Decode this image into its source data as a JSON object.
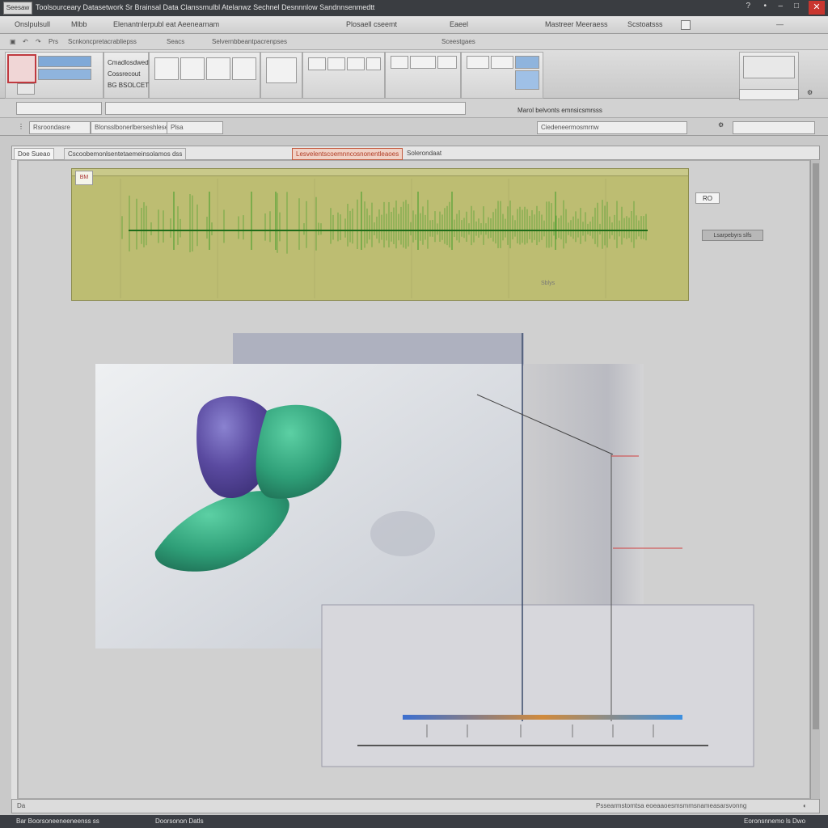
{
  "titlebar": {
    "app_button": "Seesaw",
    "title": "Toolsourceary Datasetwork   Sr Brainsal Data  Clanssmulbl Atelanwz   Sechnel Desnnnlow Sandnnsenmedtt",
    "close_glyph": "✕"
  },
  "menubar": {
    "items": [
      "Onslpulsull",
      "Mlbb",
      "Elenantnlerpubl eat Aeenearnam",
      "Plosaell cseemt",
      "Eaeel",
      "Mastreer Meeraess",
      "Scstoatsss"
    ]
  },
  "tabrow": {
    "items": [
      "Prs",
      "Scnkoncpretacrabliepss",
      "Seacs",
      "Selvernbbeantpacrenpses",
      "Sceestgaes"
    ]
  },
  "ribbon": {
    "item1": "Cmadlosdwed",
    "item2": "Cossrecout",
    "item3": "BG BSOLCET",
    "right_label": "Marol belvonts emnsicsmrsss"
  },
  "toolbar2": {
    "f1": "Rsroondasre",
    "f2": "Blonsslbonerlberseshlese",
    "f3": "Plsa",
    "f4": "Ciedeneermosmrnw"
  },
  "doctabs": {
    "tab1": "Doe Sueao",
    "tab2": "Cscoobemonlsentetaemeinsolamos dss",
    "tab3_active": "Lesvelentscoemnncosnonentleaoes",
    "tab4": "Solerondaat"
  },
  "wave": {
    "badge": "BM",
    "xlabel": "Sblys",
    "side_badge": "RO",
    "side_button": "Lsarpebyrs slfs",
    "accent": "#3c9a26",
    "baseline": "#1f6b19",
    "background": "#bdbd72"
  },
  "plot3d": {
    "color_purple": "#5a4aa0",
    "color_green": "#2e9e77",
    "axis_color": "#6a7a9a"
  },
  "statusbar": {
    "left": "Da",
    "right": "Pssearmstomtsa eoeaaoesmsmmsnameasarsvonng"
  },
  "taskbar": {
    "left": "Bar Boorsoneeneeneenss ss",
    "mid": "Doorsonon Datls",
    "right": "Eoronsnnemo ls Dwo"
  }
}
